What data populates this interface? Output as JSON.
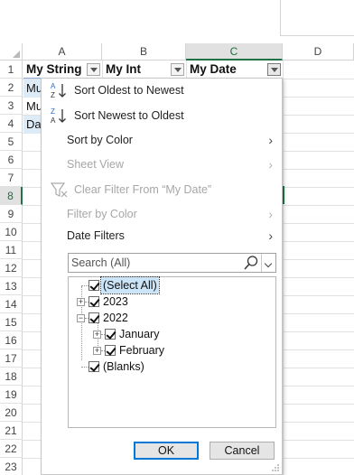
{
  "sheet": {
    "columns": [
      "A",
      "B",
      "C",
      "D"
    ],
    "active_column": "C",
    "rows": [
      "1",
      "2",
      "3",
      "4",
      "5",
      "6",
      "7",
      "8",
      "9",
      "10",
      "11",
      "12",
      "13",
      "14",
      "15",
      "16",
      "17",
      "18",
      "19",
      "20",
      "21",
      "22",
      "23"
    ],
    "active_row": "8",
    "headers": [
      "My String",
      "My Int",
      "My Date"
    ],
    "visible_cells": [
      "Mu",
      "Mu",
      "Da"
    ]
  },
  "menu": {
    "sort_oldest": "Sort Oldest to Newest",
    "sort_newest": "Sort Newest to Oldest",
    "sort_by_color": "Sort by Color",
    "sheet_view": "Sheet View",
    "clear_filter": "Clear Filter From “My Date”",
    "filter_by_color": "Filter by Color",
    "date_filters": "Date Filters",
    "search_placeholder": "Search (All)",
    "tree": {
      "select_all": "(Select All)",
      "year_2023": "2023",
      "year_2022": "2022",
      "month_january": "January",
      "month_february": "February",
      "blanks": "(Blanks)"
    },
    "ok": "OK",
    "cancel": "Cancel"
  },
  "colors": {
    "excel_green": "#217346",
    "table_band": "#ddebf7",
    "focus_blue": "#0078d7"
  },
  "icons": [
    "sort-ascending-icon",
    "sort-descending-icon",
    "chevron-right-icon",
    "clear-filter-icon",
    "search-icon",
    "chevron-down-icon",
    "checkbox-checked-icon",
    "tree-expand-icon",
    "tree-collapse-icon"
  ]
}
